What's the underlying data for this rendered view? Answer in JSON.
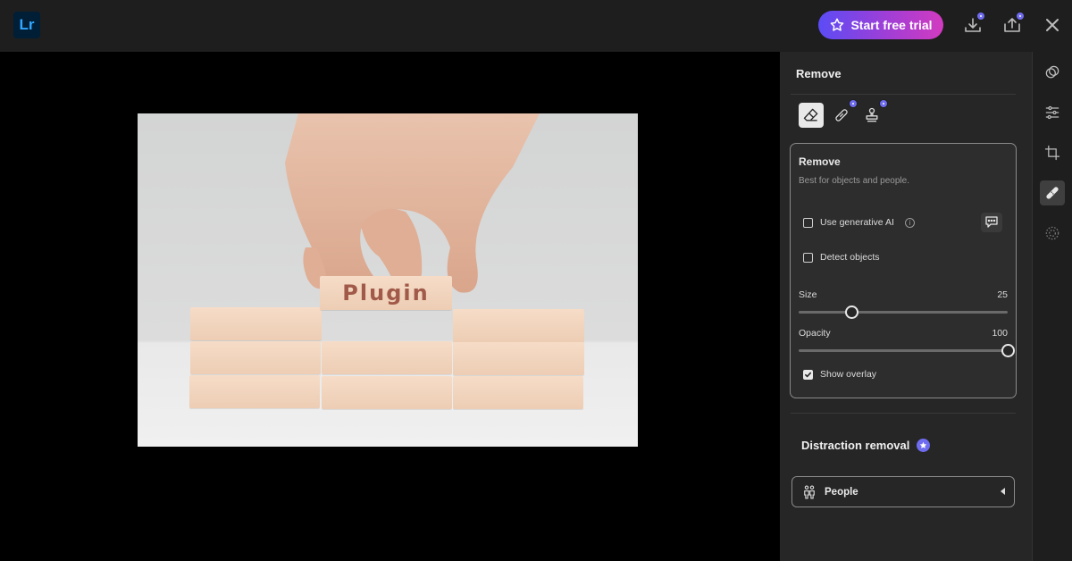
{
  "app": {
    "logo_text": "Lr"
  },
  "topbar": {
    "trial_label": "Start free trial",
    "accent_gradient": [
      "#5b4cf5",
      "#d23bc0"
    ],
    "icons": [
      "download-icon",
      "share-icon",
      "close-icon"
    ]
  },
  "photo": {
    "block_text": "Plugin"
  },
  "panel": {
    "title": "Remove",
    "tools": [
      "eraser-icon",
      "heal-brush-icon",
      "clone-stamp-icon"
    ],
    "card": {
      "title": "Remove",
      "subtitle": "Best for objects and people.",
      "generative_ai": {
        "label": "Use generative AI",
        "checked": false
      },
      "detect_objects": {
        "label": "Detect objects",
        "checked": false
      },
      "size": {
        "label": "Size",
        "value": "25",
        "min": 0,
        "max": 100
      },
      "opacity": {
        "label": "Opacity",
        "value": "100",
        "min": 0,
        "max": 100
      },
      "show_overlay": {
        "label": "Show overlay",
        "checked": true
      }
    },
    "distraction": {
      "title": "Distraction removal",
      "people_label": "People"
    }
  },
  "rail": {
    "items": [
      "presets-icon",
      "adjust-sliders-icon",
      "crop-icon",
      "healing-bandage-icon",
      "masking-icon"
    ],
    "active": "healing-bandage-icon"
  },
  "colors": {
    "badge": "#6f6cf0",
    "panel_bg": "#262626",
    "topbar_bg": "#1e1e1e"
  }
}
